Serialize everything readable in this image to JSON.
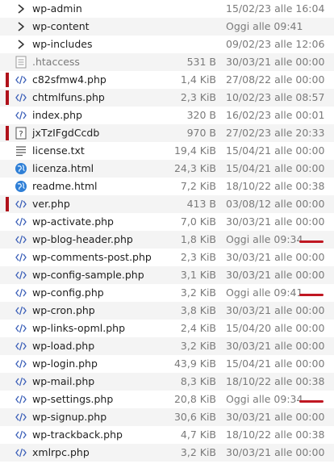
{
  "colors": {
    "marker": "#b0121b",
    "underline": "#c01722",
    "html_icon": "#2f7fd6",
    "php_icon": "#3b5fb8"
  },
  "files": [
    {
      "name": "wp-admin",
      "size": "",
      "date": "15/02/23 alle 16:04",
      "icon": "folder-icon"
    },
    {
      "name": "wp-content",
      "size": "",
      "date": "Oggi alle 09:41",
      "icon": "folder-icon"
    },
    {
      "name": "wp-includes",
      "size": "",
      "date": "09/02/23 alle 12:06",
      "icon": "folder-icon"
    },
    {
      "name": ".htaccess",
      "size": "531 B",
      "date": "30/03/21 alle 00:00",
      "icon": "config-file-icon",
      "muted": true
    },
    {
      "name": "c82sfmw4.php",
      "size": "1,4 KiB",
      "date": "27/08/22 alle 00:00",
      "icon": "php-file-icon",
      "flagged": true
    },
    {
      "name": "chtmlfuns.php",
      "size": "2,3 KiB",
      "date": "10/02/23 alle 08:57",
      "icon": "php-file-icon",
      "flagged": true
    },
    {
      "name": "index.php",
      "size": "320 B",
      "date": "16/02/23 alle 00:01",
      "icon": "php-file-icon"
    },
    {
      "name": "jxTzIFgdCcdb",
      "size": "970 B",
      "date": "27/02/23 alle 20:33",
      "icon": "unknown-file-icon",
      "flagged": true
    },
    {
      "name": "license.txt",
      "size": "19,4 KiB",
      "date": "15/04/21 alle 00:00",
      "icon": "text-file-icon"
    },
    {
      "name": "licenza.html",
      "size": "24,3 KiB",
      "date": "15/04/21 alle 00:00",
      "icon": "html-file-icon"
    },
    {
      "name": "readme.html",
      "size": "7,2 KiB",
      "date": "18/10/22 alle 00:38",
      "icon": "html-file-icon"
    },
    {
      "name": "ver.php",
      "size": "413 B",
      "date": "03/08/12 alle 00:00",
      "icon": "php-file-icon",
      "flagged": true
    },
    {
      "name": "wp-activate.php",
      "size": "7,0 KiB",
      "date": "30/03/21 alle 00:00",
      "icon": "php-file-icon"
    },
    {
      "name": "wp-blog-header.php",
      "size": "1,8 KiB",
      "date": "Oggi alle 09:34",
      "icon": "php-file-icon",
      "underlined": true
    },
    {
      "name": "wp-comments-post.php",
      "size": "2,3 KiB",
      "date": "30/03/21 alle 00:00",
      "icon": "php-file-icon"
    },
    {
      "name": "wp-config-sample.php",
      "size": "3,1 KiB",
      "date": "30/03/21 alle 00:00",
      "icon": "php-file-icon"
    },
    {
      "name": "wp-config.php",
      "size": "3,2 KiB",
      "date": "Oggi alle 09:41",
      "icon": "php-file-icon",
      "underlined": true
    },
    {
      "name": "wp-cron.php",
      "size": "3,8 KiB",
      "date": "30/03/21 alle 00:00",
      "icon": "php-file-icon"
    },
    {
      "name": "wp-links-opml.php",
      "size": "2,4 KiB",
      "date": "15/04/20 alle 00:00",
      "icon": "php-file-icon"
    },
    {
      "name": "wp-load.php",
      "size": "3,2 KiB",
      "date": "30/03/21 alle 00:00",
      "icon": "php-file-icon"
    },
    {
      "name": "wp-login.php",
      "size": "43,9 KiB",
      "date": "15/04/21 alle 00:00",
      "icon": "php-file-icon"
    },
    {
      "name": "wp-mail.php",
      "size": "8,3 KiB",
      "date": "18/10/22 alle 00:38",
      "icon": "php-file-icon"
    },
    {
      "name": "wp-settings.php",
      "size": "20,8 KiB",
      "date": "Oggi alle 09:34",
      "icon": "php-file-icon",
      "underlined": true
    },
    {
      "name": "wp-signup.php",
      "size": "30,6 KiB",
      "date": "30/03/21 alle 00:00",
      "icon": "php-file-icon"
    },
    {
      "name": "wp-trackback.php",
      "size": "4,7 KiB",
      "date": "18/10/22 alle 00:38",
      "icon": "php-file-icon"
    },
    {
      "name": "xmlrpc.php",
      "size": "3,2 KiB",
      "date": "30/03/21 alle 00:00",
      "icon": "php-file-icon"
    }
  ]
}
